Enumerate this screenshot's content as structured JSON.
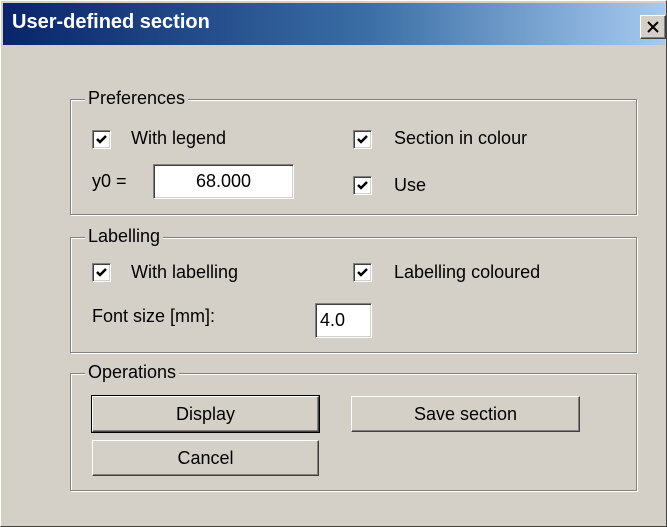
{
  "window": {
    "title": "User-defined section"
  },
  "preferences": {
    "legend": "Preferences",
    "with_legend": {
      "label": "With legend",
      "checked": true
    },
    "section_in_colour": {
      "label": "Section in colour",
      "checked": true
    },
    "y0_label": "y0 =",
    "y0_value": "68.000",
    "use": {
      "label": "Use",
      "checked": true
    }
  },
  "labelling": {
    "legend": "Labelling",
    "with_labelling": {
      "label": "With labelling",
      "checked": true
    },
    "labelling_coloured": {
      "label": "Labelling coloured",
      "checked": true
    },
    "font_size_label": "Font size [mm]:",
    "font_size_value": "4.0"
  },
  "operations": {
    "legend": "Operations",
    "display": "Display",
    "save_section": "Save section",
    "cancel": "Cancel"
  },
  "icons": {
    "close": "close-icon",
    "check": "checkmark-icon"
  }
}
